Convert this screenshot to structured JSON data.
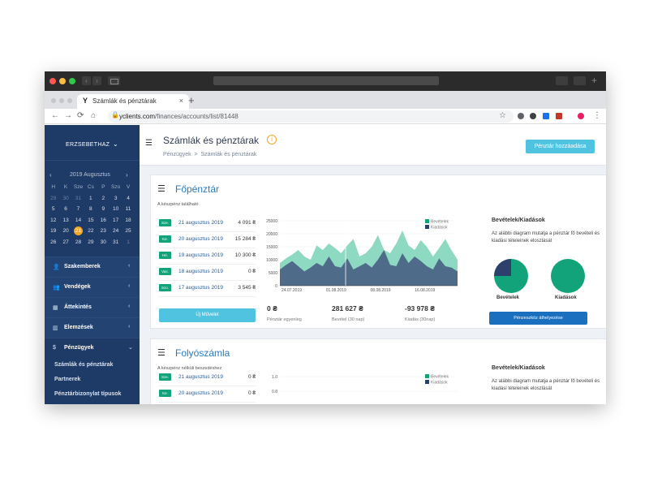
{
  "browser": {
    "tab_title": "Számlák és pénztárak",
    "url_host": "yclients.com",
    "url_path": "/finances/accounts/list/81448"
  },
  "sidebar": {
    "user": "ERZSEBETHAZ",
    "calendar": {
      "title": "2019 Augusztus",
      "dow": [
        "H",
        "K",
        "Sze",
        "Cs",
        "P",
        "Szo",
        "V"
      ],
      "weeks": [
        [
          "29",
          "30",
          "31",
          "1",
          "2",
          "3",
          "4"
        ],
        [
          "5",
          "6",
          "7",
          "8",
          "9",
          "10",
          "11"
        ],
        [
          "12",
          "13",
          "14",
          "15",
          "16",
          "17",
          "18"
        ],
        [
          "19",
          "20",
          "21",
          "22",
          "23",
          "24",
          "25"
        ],
        [
          "26",
          "27",
          "28",
          "29",
          "30",
          "31",
          "1"
        ]
      ],
      "today": "21"
    },
    "menu": [
      {
        "label": "Szakemberek",
        "icon": "user-icon"
      },
      {
        "label": "Vendégek",
        "icon": "users-icon"
      },
      {
        "label": "Áttekintés",
        "icon": "grid-icon"
      },
      {
        "label": "Elemzések",
        "icon": "bar-chart-icon"
      },
      {
        "label": "Pénzügyek",
        "icon": "dollar-icon"
      }
    ],
    "submenu": [
      "Számlák és pénztárak",
      "Partnerek",
      "Pénztárbizonylat típusok"
    ]
  },
  "header": {
    "title": "Számlák és pénztárak",
    "breadcrumb_root": "Pénzügyek",
    "breadcrumb_sep": ">",
    "breadcrumb_current": "Számlák és pénztárak",
    "add_button": "Pénztár hozzáadása"
  },
  "card1": {
    "title": "Főpénztár",
    "subtitle": "A készpénz található",
    "rows": [
      {
        "badge": "Sze.",
        "date": "21 augusztus 2019",
        "amount": "4 091 ₴"
      },
      {
        "badge": "Ke.",
        "date": "20 augusztus 2019",
        "amount": "15 284 ₴"
      },
      {
        "badge": "Hé.",
        "date": "19 augusztus 2019",
        "amount": "10 300 ₴"
      },
      {
        "badge": "Vas.",
        "date": "18 augusztus 2019",
        "amount": "0 ₴"
      },
      {
        "badge": "Szo.",
        "date": "17 augusztus 2019",
        "amount": "3 545 ₴"
      }
    ],
    "new_button": "Új Művelet",
    "chart_legend": [
      "Bevételek",
      "Kiadások"
    ],
    "chart_yticks": [
      "25000",
      "20000",
      "15000",
      "10000",
      "5000",
      "0"
    ],
    "chart_xticks": [
      "24.07.2019",
      "01.08.2019",
      "08.08.2019",
      "16.08.2019"
    ],
    "stats": [
      {
        "value": "0 ₴",
        "label": "Pénztár egyenleg"
      },
      {
        "value": "281 627 ₴",
        "label": "Bevétel (30 nap)"
      },
      {
        "value": "-93 978 ₴",
        "label": "Kiadás (30nap)"
      }
    ],
    "pies_title": "Bevételek/Kiadások",
    "pies_desc": "Az alábbi diagram mutatja a pénztár fő bevételi és kiadási tételeinek eloszlását",
    "pie_labels": [
      "Bevételek",
      "Kiadások"
    ],
    "pie_button": "Pénzeszköz áthelyezése"
  },
  "card2": {
    "title": "Folyószámla",
    "subtitle": "A készpénz nélküli beszedéshez",
    "rows": [
      {
        "badge": "Sze.",
        "date": "21 augusztus 2019",
        "amount": "0 ₴"
      },
      {
        "badge": "Ke.",
        "date": "20 augusztus 2019",
        "amount": "0 ₴"
      }
    ],
    "chart_legend": [
      "Bevételek",
      "Kiadások"
    ],
    "chart_yticks": [
      "1.0",
      "0.8"
    ],
    "pies_title": "Bevételek/Kiadások",
    "pies_desc": "Az alábbi diagram mutatja a pénztár fő bevételi és kiadási tételeinek eloszlását"
  },
  "colors": {
    "sidebar": "#1e3a66",
    "accent": "#4fc3e0",
    "income": "#13a37b",
    "expense": "#2d3f6b",
    "today": "#f5a623"
  }
}
